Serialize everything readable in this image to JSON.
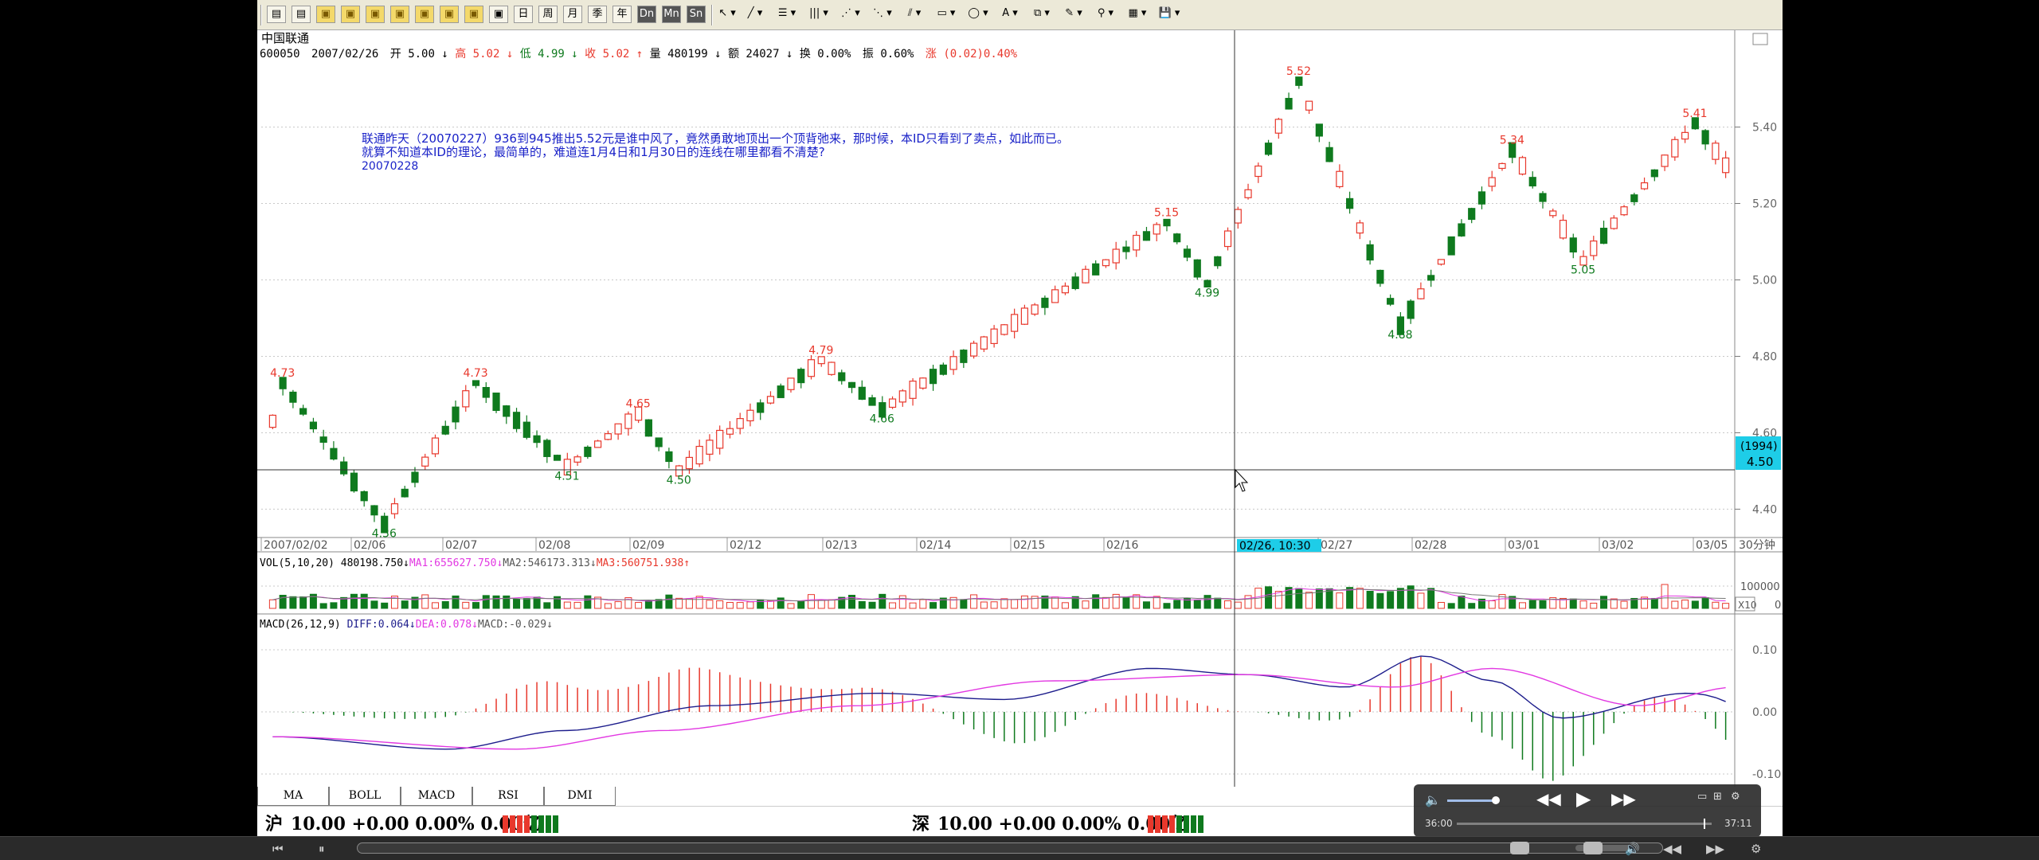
{
  "stock": {
    "name": "中国联通",
    "code": "600050",
    "date": "2007/02/26",
    "open_label": "开",
    "open": "5.00",
    "high_label": "高",
    "high": "5.02",
    "low_label": "低",
    "low": "4.99",
    "close_label": "收",
    "close": "5.02",
    "volume_label": "量",
    "volume": "480199",
    "amount_label": "额",
    "amount": "24027",
    "turnover_label": "换",
    "turnover": "0.00%",
    "amplitude_label": "振",
    "amplitude": "0.60%",
    "change_label": "涨",
    "change": "(0.02)0.40%"
  },
  "annotation": {
    "line1": "联通昨天（20070227）936到945推出5.52元是谁中风了，竟然勇敢地顶出一个顶背弛来，那时候，本ID只看到了卖点，如此而已。",
    "line2": "就算不知道本ID的理论，最简单的，难道连1月4日和1月30日的连线在哪里都看不清楚?",
    "line3": "20070228"
  },
  "chart_data": [
    {
      "type": "candlestick",
      "y_ticks": [
        "5.40",
        "5.20",
        "5.00",
        "4.80",
        "4.60",
        "4.40"
      ],
      "ylim": [
        4.33,
        5.57
      ],
      "x_ticks": [
        "2007/02/02",
        "02/06",
        "02/07",
        "02/08",
        "02/09",
        "02/12",
        "02/13",
        "02/14",
        "02/15",
        "02/16",
        "02/27",
        "02/28",
        "03/01",
        "03/02",
        "03/05"
      ],
      "x_unit": "30分钟",
      "cursor_time": "02/26, 10:30",
      "cursor_price_index": "(1994)",
      "cursor_price": "4.50",
      "annotations": [
        {
          "text": "4.73",
          "bar": 1,
          "price": 4.73,
          "kind": "high"
        },
        {
          "text": "4.36",
          "bar": 11,
          "price": 4.36,
          "kind": "low"
        },
        {
          "text": "4.73",
          "bar": 20,
          "price": 4.73,
          "kind": "high"
        },
        {
          "text": "4.51",
          "bar": 29,
          "price": 4.51,
          "kind": "low"
        },
        {
          "text": "4.65",
          "bar": 36,
          "price": 4.65,
          "kind": "high"
        },
        {
          "text": "4.50",
          "bar": 40,
          "price": 4.5,
          "kind": "low"
        },
        {
          "text": "4.79",
          "bar": 54,
          "price": 4.79,
          "kind": "high"
        },
        {
          "text": "4.66",
          "bar": 60,
          "price": 4.66,
          "kind": "low"
        },
        {
          "text": "5.15",
          "bar": 88,
          "price": 5.15,
          "kind": "high"
        },
        {
          "text": "4.99",
          "bar": 92,
          "price": 4.99,
          "kind": "low"
        },
        {
          "text": "5.52",
          "bar": 101,
          "price": 5.52,
          "kind": "high"
        },
        {
          "text": "4.88",
          "bar": 111,
          "price": 4.88,
          "kind": "low"
        },
        {
          "text": "5.34",
          "bar": 122,
          "price": 5.34,
          "kind": "high"
        },
        {
          "text": "5.05",
          "bar": 129,
          "price": 5.05,
          "kind": "low"
        },
        {
          "text": "5.41",
          "bar": 140,
          "price": 5.41,
          "kind": "high"
        }
      ]
    },
    {
      "type": "bar",
      "title": "VOL(5,10,20)",
      "value": "480198.750",
      "ma1_label": "MA1:",
      "ma1": "655627.750",
      "ma2_label": "MA2:",
      "ma2": "546173.313",
      "ma3_label": "MA3:",
      "ma3": "560751.938",
      "y_ticks": [
        "100000",
        "0"
      ],
      "unit": "X10"
    },
    {
      "type": "line",
      "title": "MACD(26,12,9)",
      "diff_label": "DIFF:",
      "diff": "0.064",
      "dea_label": "DEA:",
      "dea": "0.078",
      "macd_label": "MACD:",
      "macd": "-0.029",
      "y_ticks": [
        "0.10",
        "0.00",
        "-0.10"
      ]
    }
  ],
  "tabs": [
    "MA",
    "BOLL",
    "MACD",
    "RSI",
    "DMI"
  ],
  "status": {
    "sh_label": "沪",
    "sh": "10.00 +0.00 0.00% 0.00亿",
    "sz_label": "深",
    "sz": "10.00 +0.00 0.00% 0.00亿"
  },
  "player": {
    "time_current": "36:00",
    "time_total": "37:11"
  },
  "toolbar_labels": [
    "日",
    "周",
    "月",
    "季",
    "年",
    "Dn",
    "Mn",
    "Sn"
  ],
  "colors": {
    "up": "#e8382c",
    "down": "#0f7a1e",
    "grid": "#c8c8c8",
    "diff": "#1d1d8c",
    "dea": "#e238e2",
    "cursor": "#1ecde8"
  }
}
